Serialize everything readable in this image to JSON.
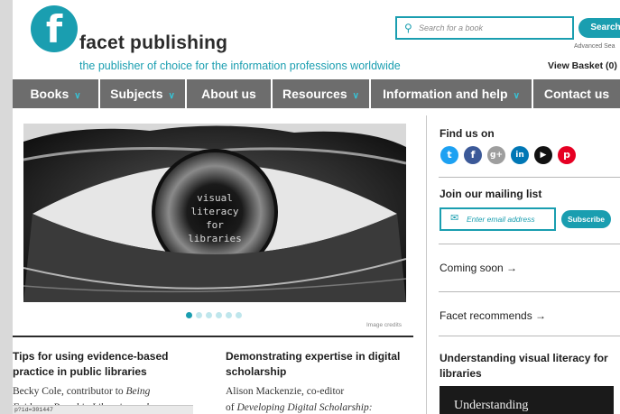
{
  "header": {
    "logo_letter": "f",
    "brand": "facet publishing",
    "tagline": "the publisher of choice for the information professions worldwide",
    "search_placeholder": "Search for a book",
    "search_button": "Search",
    "advanced_search": "Advanced Sea",
    "basket": "View Basket (0) ▼"
  },
  "nav": {
    "items": [
      {
        "label": "Books",
        "dropdown": true
      },
      {
        "label": "Subjects",
        "dropdown": true
      },
      {
        "label": "About us",
        "dropdown": false
      },
      {
        "label": "Resources",
        "dropdown": true
      },
      {
        "label": "Information and help",
        "dropdown": true
      },
      {
        "label": "Contact us",
        "dropdown": false
      }
    ]
  },
  "hero": {
    "line1": "visual",
    "line2": "literacy",
    "line3": "for",
    "line4": "libraries",
    "slide_count": 6,
    "active_slide": 1,
    "credits": "Image credits"
  },
  "articles": [
    {
      "title_line1": "Tips for using evidence-based",
      "title_line2": "practice in public libraries",
      "author_prefix": "Becky Cole, contributor to ",
      "author_book": "Being",
      "next_line": "Evidence Based in Libraries and"
    },
    {
      "title_line1": "Demonstrating expertise in digital",
      "title_line2": "scholarship",
      "author_line": "Alison Mackenzie, co-editor",
      "book_prefix": "of ",
      "book_title": "Developing Digital Scholarship:"
    }
  ],
  "sidebar": {
    "find_us": "Find us on",
    "social": [
      {
        "icon": "twitter-icon",
        "glyph": "t",
        "color": "#1da1f2"
      },
      {
        "icon": "facebook-icon",
        "glyph": "f",
        "color": "#3b5998"
      },
      {
        "icon": "googleplus-icon",
        "glyph": "g+",
        "color": "#9e9e9e"
      },
      {
        "icon": "linkedin-icon",
        "glyph": "in",
        "color": "#0077b5"
      },
      {
        "icon": "youtube-icon",
        "glyph": "▶",
        "color": "#111111"
      },
      {
        "icon": "pinterest-icon",
        "glyph": "p",
        "color": "#e60023"
      }
    ],
    "mailing_list": "Join our mailing list",
    "email_placeholder": "Enter email address",
    "subscribe": "Subscribe",
    "coming_soon": "Coming soon →",
    "recommends": "Facet recommends →",
    "feature_title_line1": "Understanding visual literacy for",
    "feature_title_line2": "libraries",
    "feature_cover": "Understanding"
  },
  "status_bar": "p?id=301447",
  "colors": {
    "accent": "#1a9eb0",
    "nav_bg": "#6d6d6d"
  }
}
